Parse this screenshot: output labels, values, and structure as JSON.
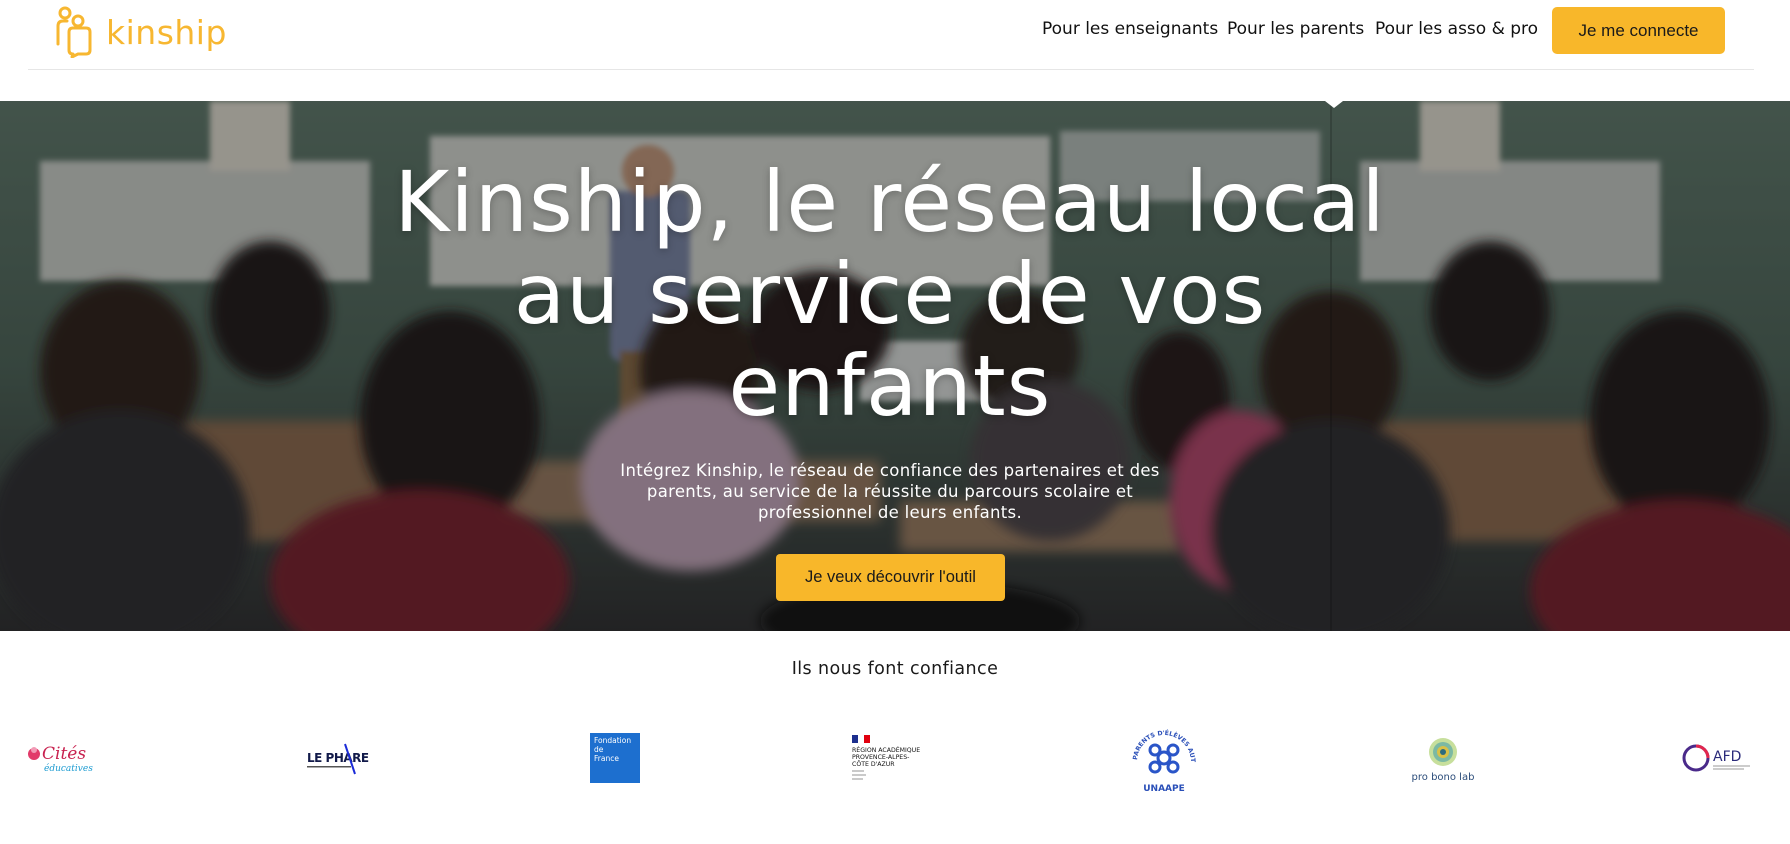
{
  "brand": {
    "name": "kinship",
    "color": "#f7b731"
  },
  "nav": {
    "links": [
      {
        "label": "Pour les enseignants"
      },
      {
        "label": "Pour les parents"
      },
      {
        "label": "Pour les asso & pro"
      }
    ],
    "login_label": "Je me connecte"
  },
  "hero": {
    "title_line1": "Kinship, le réseau local",
    "title_line2": "au service de vos",
    "title_line3": "enfants",
    "subtitle_line1": "Intégrez Kinship, le réseau de confiance des partenaires et des",
    "subtitle_line2": "parents, au service de la réussite du parcours scolaire et",
    "subtitle_line3": "professionnel de leurs enfants.",
    "cta_label": "Je veux découvrir l'outil"
  },
  "partners": {
    "title": "Ils nous font confiance",
    "logos": [
      {
        "icon": "cites-educatives-logo",
        "text_main": "Cités",
        "text_sub": "éducatives"
      },
      {
        "icon": "le-phare-logo",
        "text_main": "LE PHARE"
      },
      {
        "icon": "fondation-de-france-logo",
        "text_line1": "Fondation",
        "text_line2": "de",
        "text_line3": "France"
      },
      {
        "icon": "region-sud-logo",
        "text_line1": "RÉGION ACADÉMIQUE",
        "text_line2": "PROVENCE-ALPES-",
        "text_line3": "CÔTE D'AZUR"
      },
      {
        "icon": "unaape-logo",
        "text_main": "UNAAPE",
        "text_ring": "PARENTS D'ÉLÈVES AUTONOMES"
      },
      {
        "icon": "pro-bono-lab-logo",
        "text_main": "pro bono lab"
      },
      {
        "icon": "afd-logo",
        "text_main": "AFD"
      }
    ]
  },
  "colors": {
    "accent": "#f8b72a",
    "text": "#1a1a1a"
  }
}
